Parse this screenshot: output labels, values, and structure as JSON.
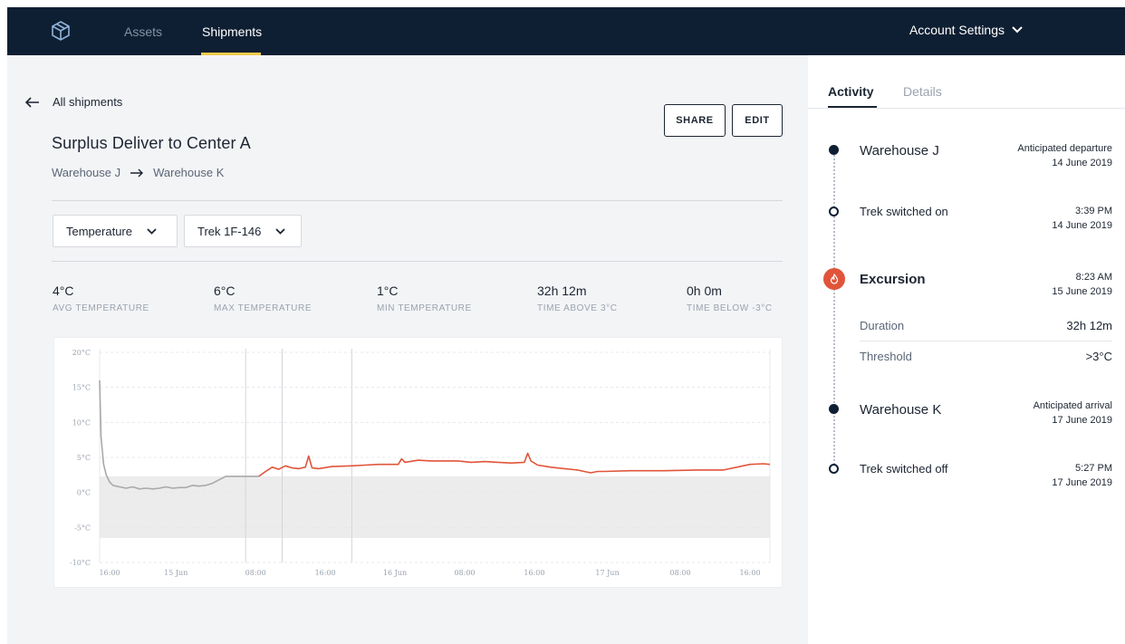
{
  "nav": {
    "logo_icon": "cube-icon",
    "tabs": [
      {
        "label": "Assets",
        "active": false
      },
      {
        "label": "Shipments",
        "active": true
      }
    ],
    "account_label": "Account Settings",
    "colors": {
      "bar": "#0f1f33",
      "active_underline": "#f2c94c"
    }
  },
  "shipment": {
    "back_label": "All shipments",
    "title": "Surplus Deliver to Center A",
    "origin": "Warehouse J",
    "destination": "Warehouse K",
    "share_label": "SHARE",
    "edit_label": "EDIT",
    "metric_select": "Temperature",
    "device_select": "Trek 1F-146"
  },
  "stats": [
    {
      "value": "4°C",
      "label": "AVG TEMPERATURE"
    },
    {
      "value": "6°C",
      "label": "MAX TEMPERATURE"
    },
    {
      "value": "1°C",
      "label": "MIN TEMPERATURE"
    },
    {
      "value": "32h 12m",
      "label": "TIME ABOVE 3°C"
    },
    {
      "value": "0h 0m",
      "label": "TIME BELOW -3°C"
    }
  ],
  "chart_data": {
    "type": "line",
    "title": "",
    "xlabel": "",
    "ylabel": "",
    "ylim": [
      -10,
      20
    ],
    "y_ticks": [
      "20°C",
      "15°C",
      "10°C",
      "5°C",
      "0°C",
      "-5°C",
      "-10°C"
    ],
    "x_ticks": [
      "16:00",
      "15 Jun",
      "08:00",
      "16:00",
      "16 Jun",
      "08:00",
      "16:00",
      "17 Jun",
      "08:00",
      "16:00"
    ],
    "threshold_band": [
      -6.5,
      2.3
    ],
    "colors": {
      "in_range": "#a9a9a9",
      "excursion": "#e0553a",
      "band": "#ececec"
    },
    "series": [
      {
        "x": [
          0,
          0.2,
          0.6,
          1.0,
          1.5,
          2.0,
          3,
          4,
          5,
          6,
          7,
          8,
          9,
          10,
          11,
          12,
          13,
          14,
          15,
          16,
          17,
          18,
          19,
          20,
          21,
          22,
          23,
          24
        ],
        "y": [
          16,
          8,
          4,
          2.5,
          1.5,
          1,
          0.8,
          0.6,
          0.8,
          0.5,
          0.6,
          0.5,
          0.6,
          0.8,
          0.6,
          0.7,
          0.7,
          1,
          0.9,
          1,
          1.3,
          1.8,
          2.3,
          2.3,
          2.3,
          2.3,
          2.3,
          2.3
        ]
      },
      {
        "x": [
          24,
          25,
          26,
          27,
          28,
          29,
          30,
          31,
          31.5,
          32,
          33,
          35,
          38,
          40,
          42,
          44,
          45,
          45.5,
          46,
          48,
          50,
          52,
          54,
          56,
          58,
          60,
          62,
          64,
          64.5,
          65,
          66,
          68,
          70,
          72,
          73,
          74,
          75,
          76,
          80,
          85,
          90,
          94,
          96,
          98,
          100,
          101
        ],
        "y": [
          2.3,
          3,
          3.6,
          3.3,
          3.8,
          3.5,
          3.4,
          3.6,
          5.2,
          3.5,
          3.4,
          3.7,
          3.8,
          3.9,
          4,
          4,
          4,
          4.8,
          4.3,
          4.6,
          4.5,
          4.5,
          4.5,
          4.3,
          4.4,
          4.3,
          4.2,
          4.3,
          5.6,
          4.5,
          3.9,
          3.6,
          3.4,
          3.2,
          3.0,
          2.8,
          3.0,
          3.0,
          3.1,
          3.1,
          3.2,
          3.2,
          3.6,
          4.0,
          4.1,
          4.0
        ]
      }
    ]
  },
  "sidebar": {
    "tabs": [
      {
        "label": "Activity",
        "active": true
      },
      {
        "label": "Details",
        "active": false
      }
    ],
    "events": [
      {
        "title": "Warehouse J",
        "line1": "Anticipated departure",
        "line2": "14 June 2019",
        "marker": "filled"
      },
      {
        "title": "Trek switched on",
        "line1": "3:39 PM",
        "line2": "14 June 2019",
        "marker": "open"
      },
      {
        "title": "Excursion",
        "line1": "8:23 AM",
        "line2": "15 June 2019",
        "marker": "excursion"
      },
      {
        "title": "Warehouse K",
        "line1": "Anticipated arrival",
        "line2": "17 June 2019",
        "marker": "filled"
      },
      {
        "title": "Trek switched off",
        "line1": "5:27 PM",
        "line2": "17 June 2019",
        "marker": "open"
      }
    ],
    "excursion_details": [
      {
        "label": "Duration",
        "value": "32h 12m"
      },
      {
        "label": "Threshold",
        "value": ">3°C"
      }
    ]
  }
}
